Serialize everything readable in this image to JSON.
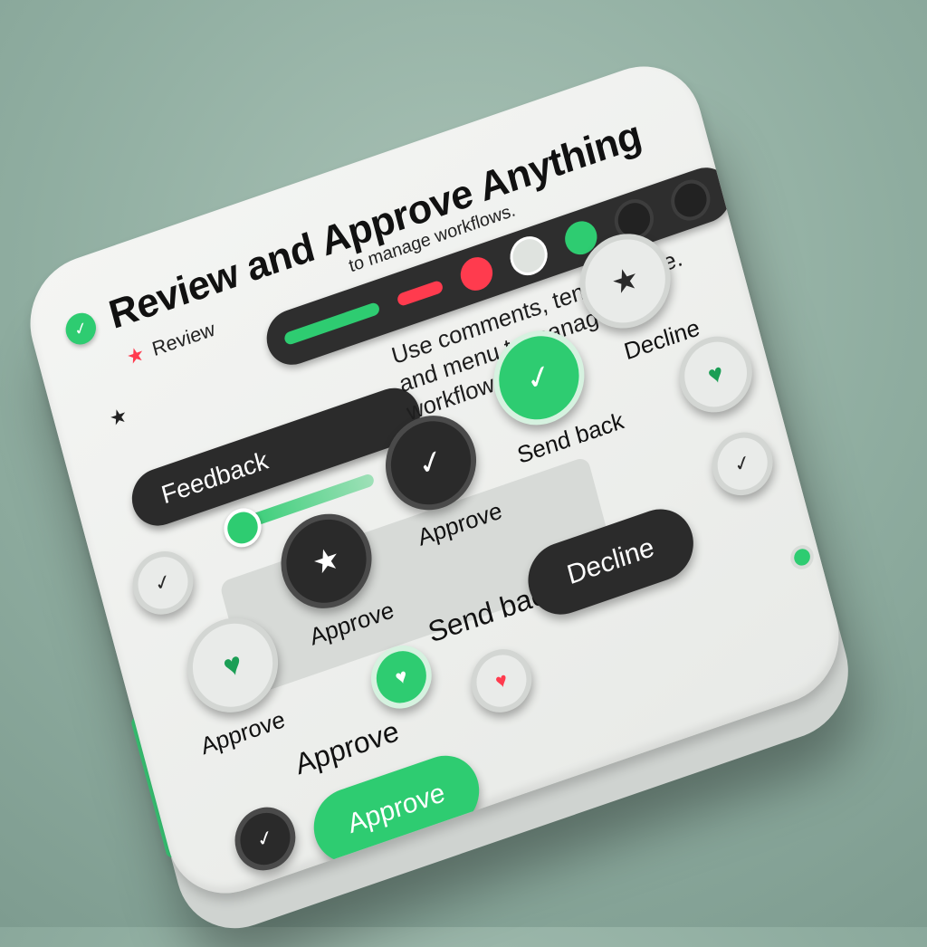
{
  "header": {
    "title": "Review and Approve Anything",
    "subtitle": "to manage workflows."
  },
  "tags": {
    "review": "Review"
  },
  "feedback": {
    "label": "Feedback"
  },
  "info": {
    "text": "Use comments, tend change. and menu to manage workflows."
  },
  "actions": {
    "approve_1": "Approve",
    "approve_2": "Approve",
    "approve_3": "Approve",
    "approve_4": "Approve",
    "send_back_1": "Send back",
    "send_back_2": "Send back",
    "decline_label": "Decline",
    "decline_button": "Decline",
    "approve_button": "Approve"
  },
  "colors": {
    "accent": "#2ecc71",
    "alert": "#ff3b4e",
    "dark": "#2b2b2b",
    "panel": "#f0f1ef"
  },
  "icons": [
    "check-icon",
    "star-icon",
    "heart-icon",
    "gear-icon"
  ]
}
